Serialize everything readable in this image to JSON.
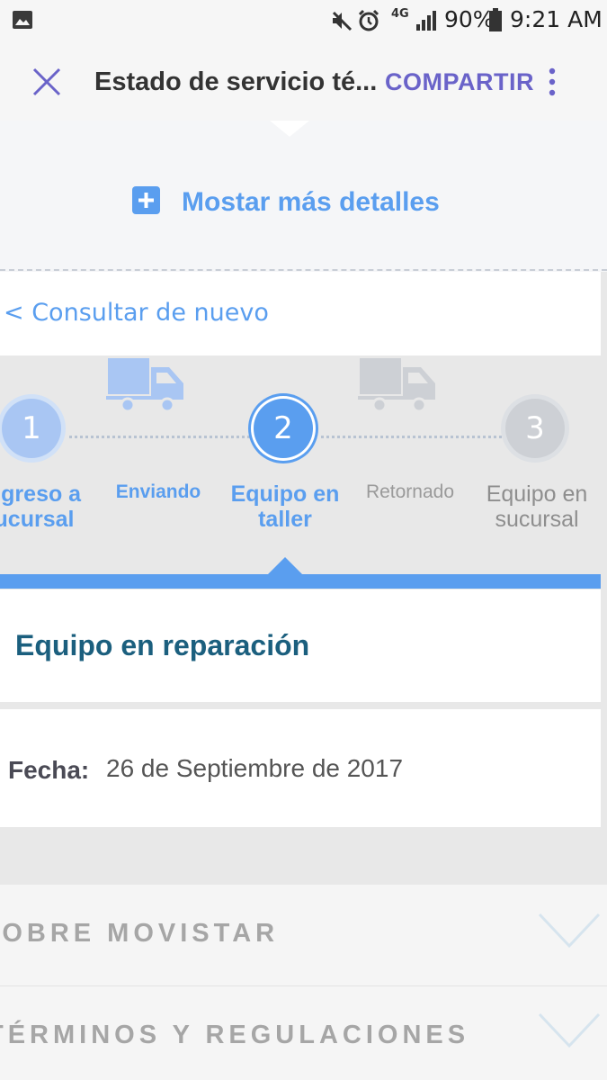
{
  "status_bar": {
    "network": "4G",
    "battery": "90%",
    "time": "9:21 AM"
  },
  "app_bar": {
    "title": "Estado de servicio té...",
    "share_label": "COMPARTIR"
  },
  "details": {
    "show_more_label": "Mostar más detalles",
    "query_again_label": "< Consultar de nuevo"
  },
  "steps": {
    "items": [
      {
        "number": "1",
        "label_line1": "ngreso a",
        "label_line2": "ucursal",
        "state": "done"
      },
      {
        "number": "2",
        "label_line1": "Equipo en",
        "label_line2": "taller",
        "state": "current"
      },
      {
        "number": "3",
        "label_line1": "Equipo en",
        "label_line2": "sucursal",
        "state": "pending"
      }
    ],
    "transit": [
      {
        "label": "Enviando",
        "state": "done"
      },
      {
        "label": "Retornado",
        "state": "pending"
      }
    ]
  },
  "status": {
    "title": "Equipo en reparación",
    "date_label": "Fecha:",
    "date_value": "26 de Septiembre de 2017"
  },
  "footer": {
    "about_label": "SOBRE MOVISTAR",
    "terms_label": "TÉRMINOS Y REGULACIONES"
  },
  "colors": {
    "accent": "#5a9eef",
    "brand_purple": "#6a63c9",
    "title_teal": "#1b5f7e"
  },
  "icons": [
    "image-icon",
    "mute-icon",
    "alarm-icon",
    "signal-icon",
    "battery-icon",
    "close-icon",
    "more-vert-icon",
    "plus-square-icon",
    "truck-icon",
    "chevron-down-icon"
  ]
}
